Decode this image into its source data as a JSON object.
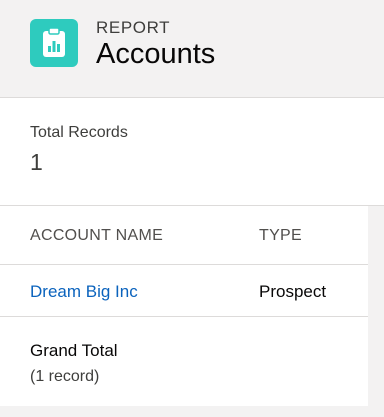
{
  "header": {
    "icon": "report-icon",
    "eyebrow": "REPORT",
    "title": "Accounts"
  },
  "summary": {
    "label": "Total Records",
    "value": "1"
  },
  "table": {
    "columns": [
      "ACCOUNT NAME",
      "TYPE"
    ],
    "rows": [
      {
        "account_name": "Dream Big Inc",
        "type": "Prospect"
      }
    ],
    "grand_total": {
      "label": "Grand Total",
      "sub": "(1 record)"
    }
  },
  "colors": {
    "icon_bg": "#2ecbbe",
    "link": "#0b63bd",
    "header_bg": "#f3f2f2"
  }
}
